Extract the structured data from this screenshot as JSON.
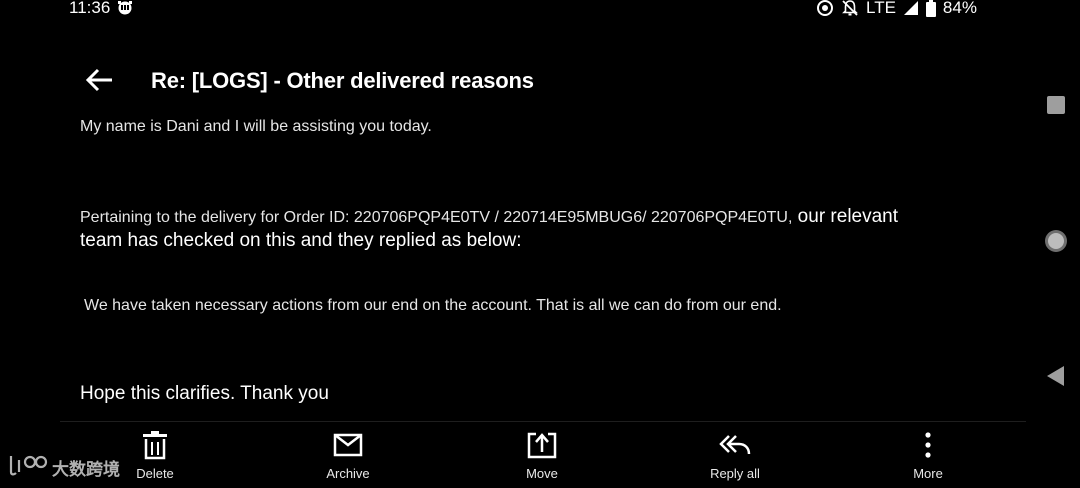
{
  "status_bar": {
    "time": "11:36",
    "network": "LTE",
    "battery": "84%"
  },
  "header": {
    "subject": "Re: [LOGS] - Other delivered reasons"
  },
  "message": {
    "greeting": "My name is Dani and I will be assisting you today.",
    "pertaining_prefix": "Pertaining to the delivery for Order ID:  220706PQP4E0TV / 220714E95MBUG6/ 220706PQP4E0TU,",
    "pertaining_suffix": " our relevant",
    "team_line": "team has checked on this and they replied as below:",
    "actions_line": "We have taken necessary actions from our end on the account. That is all we can do from our end.",
    "closing": "Hope this clarifies. Thank you"
  },
  "toolbar": {
    "delete_label": "Delete",
    "archive_label": "Archive",
    "move_label": "Move",
    "reply_all_label": "Reply all",
    "more_label": "More"
  },
  "watermark": {
    "text": "大数跨境"
  },
  "colors": {
    "background": "#000000",
    "text": "#ffffff",
    "nav_icons": "#9e9e9e"
  }
}
